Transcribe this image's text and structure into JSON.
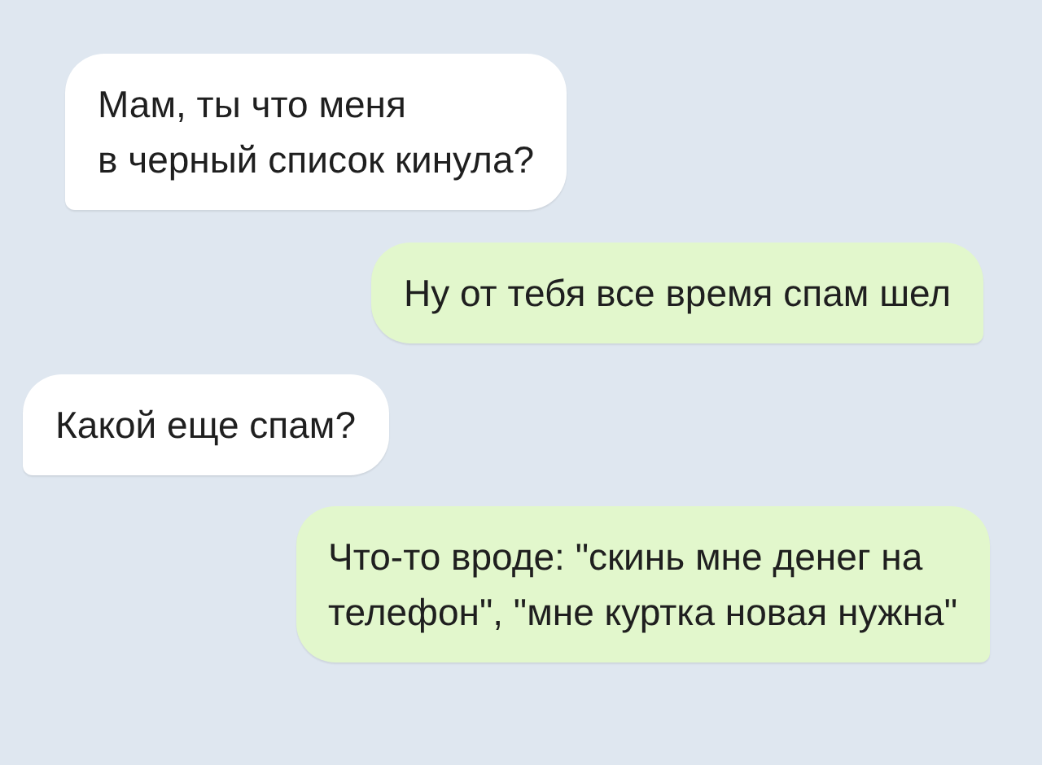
{
  "messages": [
    {
      "kind": "incoming",
      "text": "Мам, ты что меня\nв черный список кинула?"
    },
    {
      "kind": "outgoing",
      "text": "Ну от тебя все время спам шел"
    },
    {
      "kind": "incoming",
      "text": "Какой еще спам?"
    },
    {
      "kind": "outgoing",
      "text": "Что-то вроде: \"скинь мне денег на\nтелефон\", \"мне куртка новая нужна\""
    }
  ]
}
